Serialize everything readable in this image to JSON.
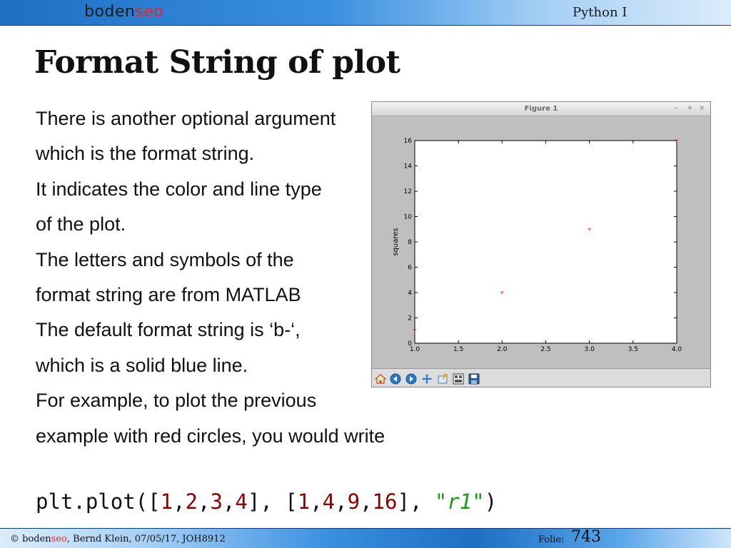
{
  "header": {
    "logo_text_prefix": "boden",
    "logo_text_suffix": "seo",
    "course_title": "Python I"
  },
  "slide": {
    "title": "Format String of plot",
    "lines": [
      "There is another optional argument",
      "which is the format string.",
      "It indicates the color and line type",
      "of the plot.",
      "The letters and symbols of the",
      "format string are from MATLAB",
      "The default format string is ‘b-‘,",
      "which is a solid blue line.",
      "For example, to plot the previous",
      "example with red circles, you would write"
    ],
    "code": {
      "prefix": "plt.plot([",
      "x": [
        "1",
        "2",
        "3",
        "4"
      ],
      "middle": "], [",
      "y": [
        "1",
        "4",
        "9",
        "16"
      ],
      "sep": ", ",
      "fmt": "r1",
      "suffix": ")"
    }
  },
  "figure_window": {
    "title": "Figure 1",
    "controls": {
      "minimize": "–",
      "maximize": "+",
      "close": "×"
    },
    "toolbar": [
      "home-icon",
      "back-icon",
      "forward-icon",
      "pan-icon",
      "zoom-icon",
      "subplots-icon",
      "save-icon"
    ]
  },
  "chart_data": {
    "type": "scatter",
    "x": [
      1,
      2,
      3,
      4
    ],
    "y": [
      1,
      4,
      9,
      16
    ],
    "marker_color": "#ff0000",
    "title": "",
    "xlabel": "",
    "ylabel": "squares",
    "xlim": [
      1.0,
      4.0
    ],
    "ylim": [
      0,
      16
    ],
    "xticks": [
      "1.0",
      "1.5",
      "2.0",
      "2.5",
      "3.0",
      "3.5",
      "4.0"
    ],
    "yticks": [
      "0",
      "2",
      "4",
      "6",
      "8",
      "10",
      "12",
      "14",
      "16"
    ],
    "grid": false
  },
  "footer": {
    "copyright_prefix": "© boden",
    "copyright_seo": "seo",
    "copyright_rest": ", Bernd Klein, 07/05/17, JOH8912",
    "folie_label": "Folie:",
    "page_number": "743"
  }
}
